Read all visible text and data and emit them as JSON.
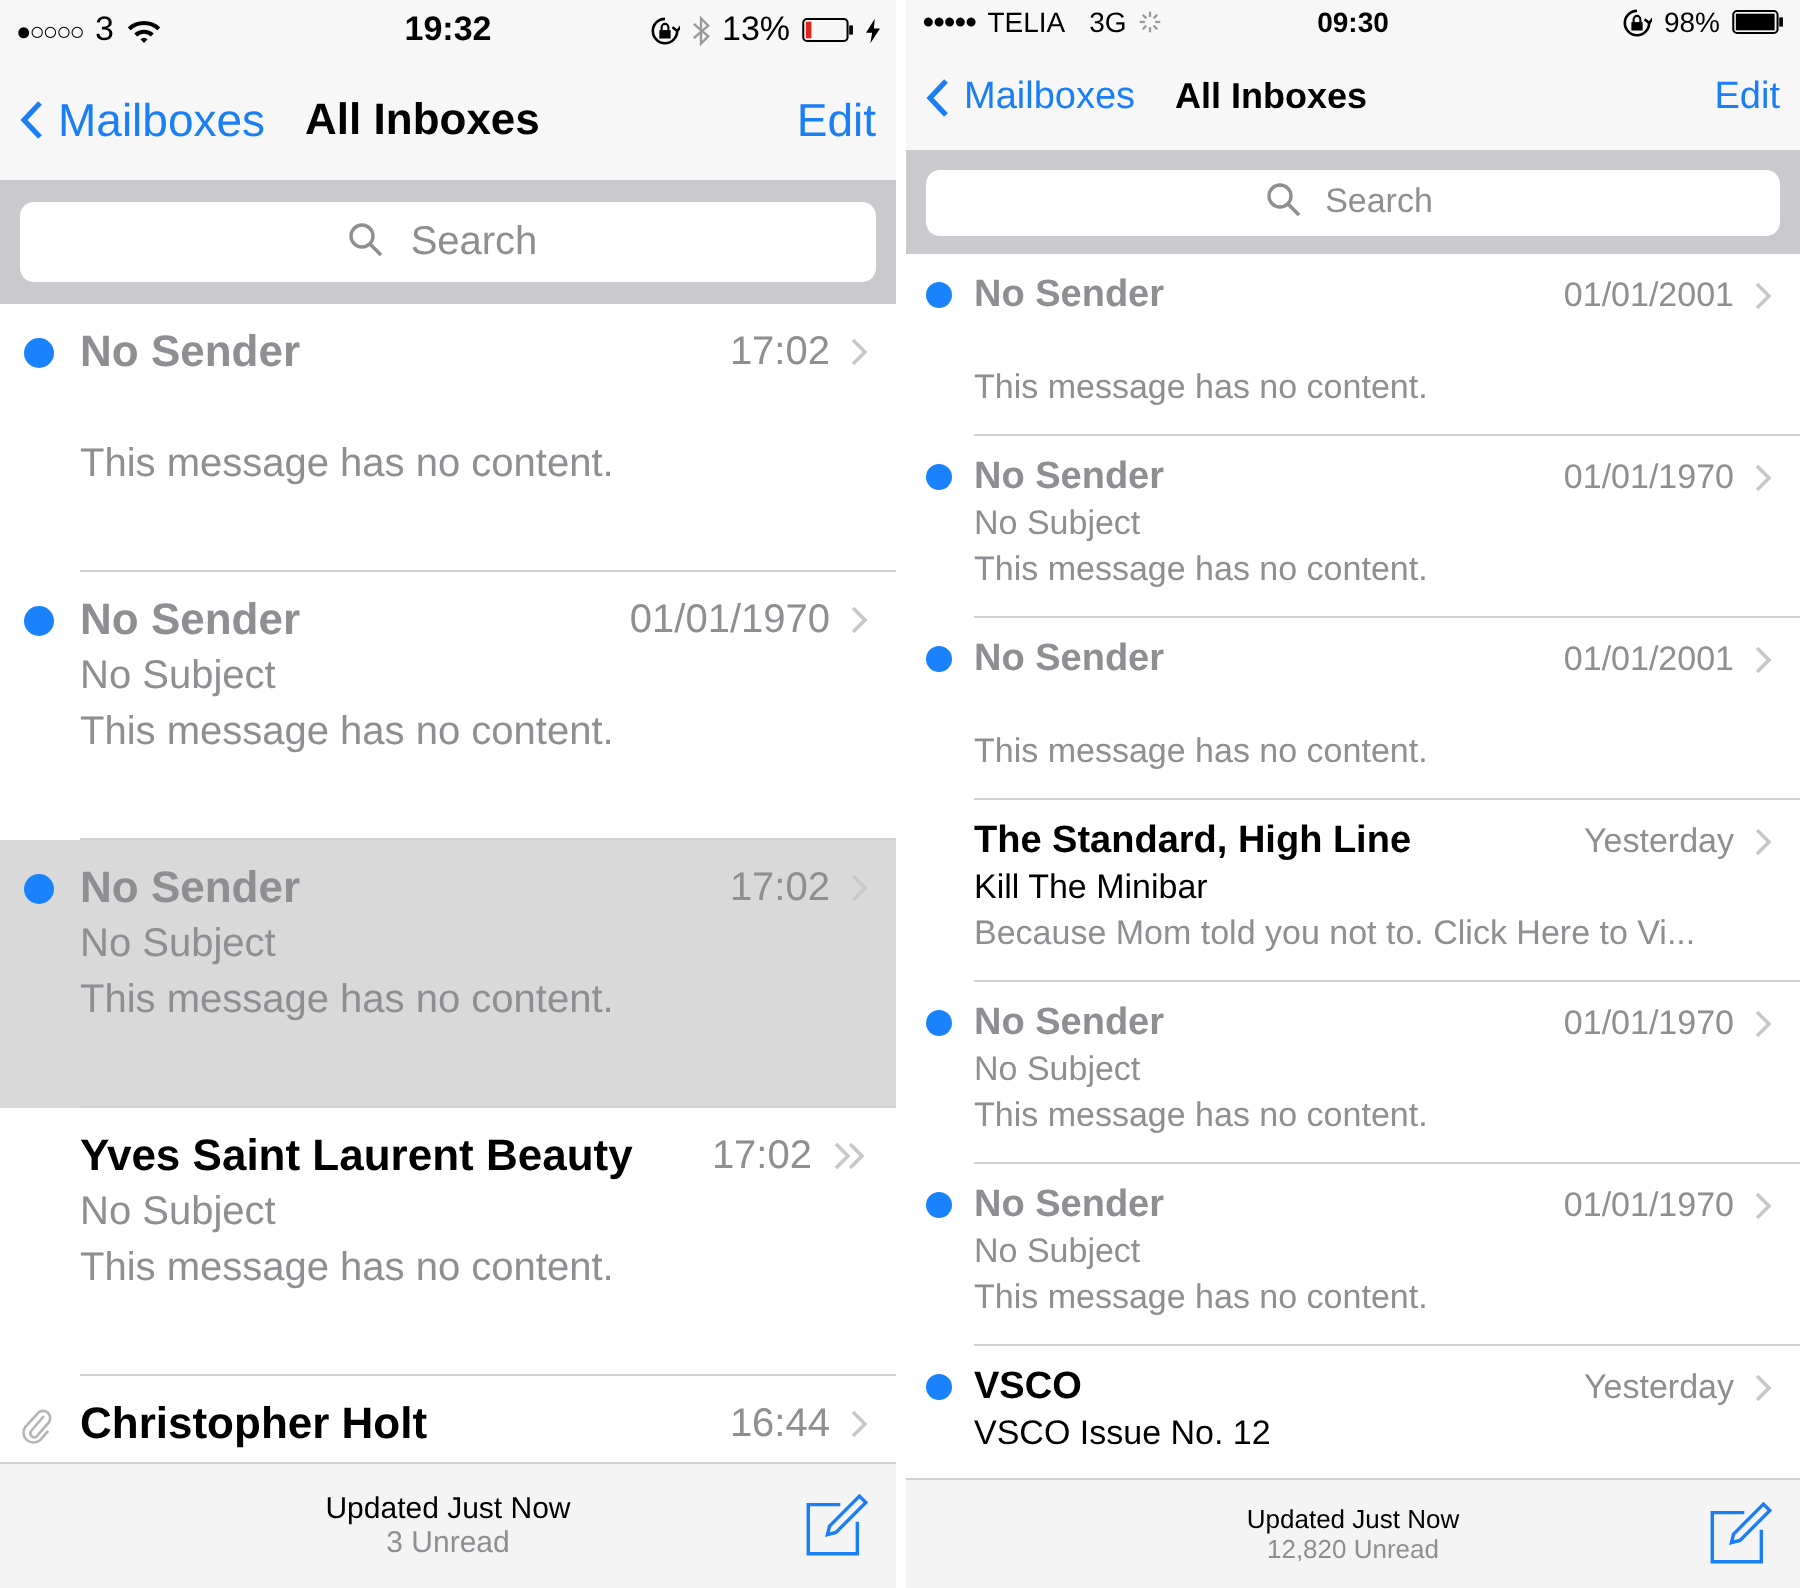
{
  "phones": [
    {
      "status_bar": {
        "signal": "●○○○○",
        "carrier": "3",
        "wifi": true,
        "time": "19:32",
        "orientation_lock": true,
        "bluetooth": true,
        "battery": "13%",
        "battery_low": true,
        "charging": true
      },
      "nav": {
        "back": "Mailboxes",
        "title": "All Inboxes",
        "action": "Edit"
      },
      "search": {
        "placeholder": "Search"
      },
      "messages": [
        {
          "sender": "No Sender",
          "sender_muted": true,
          "date": "17:02",
          "preview": "This message has no content.",
          "unread": true,
          "selected": false,
          "thread": false
        },
        {
          "sender": "No Sender",
          "sender_muted": true,
          "date": "01/01/1970",
          "subject": "No Subject",
          "subject_muted": true,
          "preview": "This message has no content.",
          "unread": true,
          "selected": false,
          "thread": false
        },
        {
          "sender": "No Sender",
          "sender_muted": true,
          "date": "17:02",
          "subject": "No Subject",
          "subject_muted": true,
          "preview": "This message has no content.",
          "unread": true,
          "selected": true,
          "thread": false
        },
        {
          "sender": "Yves Saint Laurent Beauty",
          "sender_muted": false,
          "date": "17:02",
          "subject": "No Subject",
          "subject_muted": true,
          "preview": "This message has no content.",
          "unread": false,
          "selected": false,
          "thread": true
        },
        {
          "sender": "Christopher Holt",
          "sender_muted": false,
          "date": "16:44",
          "unread": false,
          "selected": false,
          "thread": false,
          "attachment": true
        }
      ],
      "toolbar": {
        "status": "Updated Just Now",
        "count": "3 Unread"
      }
    },
    {
      "status_bar": {
        "signal": "●●●●●",
        "carrier": "TELIA",
        "network": "3G",
        "activity": true,
        "time": "09:30",
        "orientation_lock": true,
        "battery": "98%",
        "battery_low": false
      },
      "nav": {
        "back": "Mailboxes",
        "title": "All Inboxes",
        "action": "Edit"
      },
      "search": {
        "placeholder": "Search"
      },
      "messages": [
        {
          "sender": "No Sender",
          "sender_muted": true,
          "date": "01/01/2001",
          "preview": "This message has no content.",
          "unread": true,
          "selected": false,
          "thread": false
        },
        {
          "sender": "No Sender",
          "sender_muted": true,
          "date": "01/01/1970",
          "subject": "No Subject",
          "subject_muted": true,
          "preview": "This message has no content.",
          "unread": true,
          "selected": false,
          "thread": false
        },
        {
          "sender": "No Sender",
          "sender_muted": true,
          "date": "01/01/2001",
          "preview": "This message has no content.",
          "unread": true,
          "selected": false,
          "thread": false
        },
        {
          "sender": "The Standard, High Line",
          "sender_muted": false,
          "date": "Yesterday",
          "subject": "Kill The Minibar",
          "subject_muted": false,
          "preview": "Because Mom told you not to. Click Here to Vi...",
          "unread": false,
          "selected": false,
          "thread": false
        },
        {
          "sender": "No Sender",
          "sender_muted": true,
          "date": "01/01/1970",
          "subject": "No Subject",
          "subject_muted": true,
          "preview": "This message has no content.",
          "unread": true,
          "selected": false,
          "thread": false
        },
        {
          "sender": "No Sender",
          "sender_muted": true,
          "date": "01/01/1970",
          "subject": "No Subject",
          "subject_muted": true,
          "preview": "This message has no content.",
          "unread": true,
          "selected": false,
          "thread": false
        },
        {
          "sender": "VSCO",
          "sender_muted": false,
          "date": "Yesterday",
          "subject": "VSCO Issue No. 12",
          "subject_muted": false,
          "unread": true,
          "selected": false,
          "thread": false
        }
      ],
      "toolbar": {
        "status": "Updated Just Now",
        "count": "12,820 Unread"
      }
    }
  ]
}
